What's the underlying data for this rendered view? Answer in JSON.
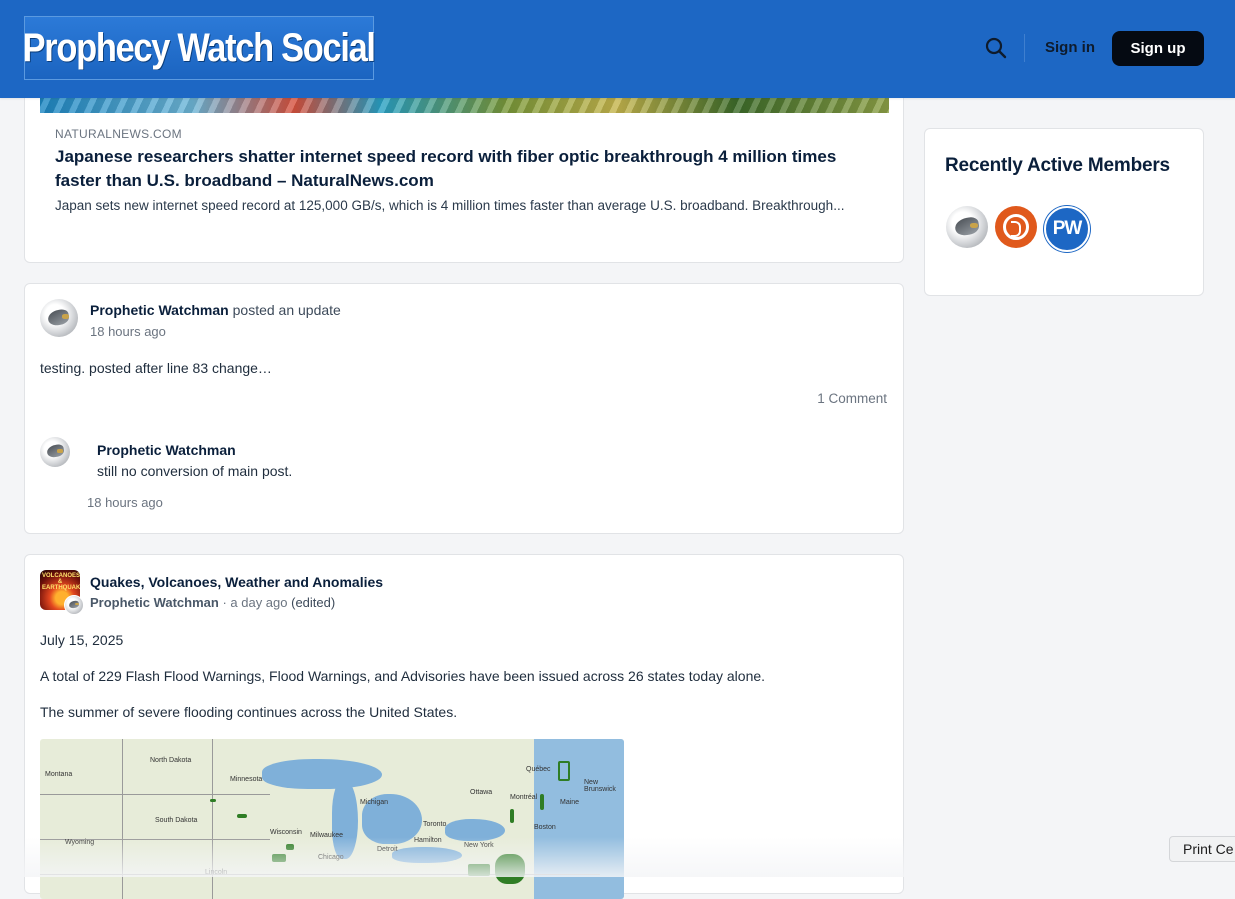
{
  "header": {
    "logo_text": "Prophecy Watch Social",
    "signin_label": "Sign in",
    "signup_label": "Sign up",
    "search_icon": "search-icon",
    "bg_color": "#1d67c4"
  },
  "posts": [
    {
      "type": "link-preview",
      "domain": "NATURALNEWS.COM",
      "title": "Japanese researchers shatter internet speed record with fiber optic breakthrough 4 million times faster than U.S. broadband – NaturalNews.com",
      "description": "Japan sets new internet speed record at 125,000 GB/s, which is 4 million times faster than average U.S. broadband. Breakthrough..."
    },
    {
      "type": "update",
      "author": "Prophetic Watchman",
      "action": "posted an update",
      "time": "18 hours ago",
      "text": "testing. posted after line 83 change…",
      "comments_label": "1 Comment",
      "comment": {
        "author": "Prophetic Watchman",
        "text": "still no conversion of main post.",
        "time": "18 hours ago"
      }
    },
    {
      "type": "group-post",
      "group": "Quakes, Volcanoes, Weather and Anomalies",
      "group_avatar_text": "VOLCANOES & EARTHQUAKES",
      "author": "Prophetic Watchman",
      "time": "· a day ago",
      "edited": "(edited)",
      "paragraphs": [
        "July 15, 2025",
        "A total of 229 Flash Flood Warnings, Flood Warnings, and Advisories have been issued across 26 states today alone.",
        "The summer of severe flooding continues across the United States."
      ],
      "map_labels": [
        "North Dakota",
        "Montana",
        "South Dakota",
        "Minnesota",
        "Wisconsin",
        "Michigan",
        "Wyoming",
        "Milwaukee",
        "Chicago",
        "Detroit",
        "Toronto",
        "Ottawa",
        "Montréal",
        "Québec",
        "Hamilton",
        "New York",
        "Boston",
        "Lincoln",
        "New Brunswick",
        "Maine"
      ]
    }
  ],
  "sidebar": {
    "title": "Recently Active Members"
  },
  "tooltip": {
    "label": "Print Ce"
  }
}
